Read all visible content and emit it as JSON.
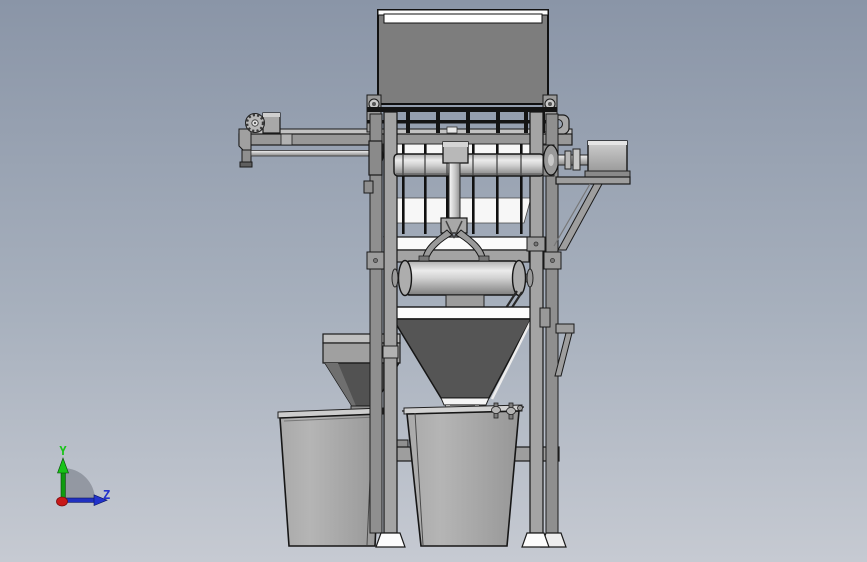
{
  "viewport": {
    "background_top": "#8A95A7",
    "background_middle": "#A7B0BD",
    "background_bottom": "#C6CAD2"
  },
  "model": {
    "body_gray": "#7D7D7D",
    "frame_gray": "#9E9E9E",
    "hopper_dark_gray": "#555555",
    "highlight_white": "#FBFBFB",
    "outline_black": "#161616"
  },
  "orientation_triad": {
    "y_axis_label": "Y",
    "y_axis_color": "#18C418",
    "z_axis_label": "Z",
    "z_axis_color": "#2233CC",
    "origin_color": "#C81818",
    "arc_color": "#8E949D"
  }
}
